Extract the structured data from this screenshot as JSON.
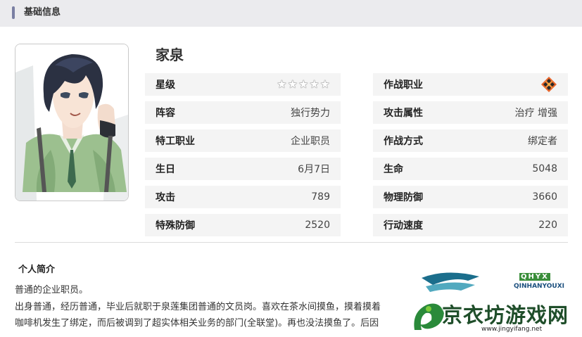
{
  "section": {
    "title": "基础信息"
  },
  "character": {
    "name": "家泉"
  },
  "stats_left": [
    {
      "key": "星级",
      "value": ""
    },
    {
      "key": "阵容",
      "value": "独行势力"
    },
    {
      "key": "特工职业",
      "value": "企业职员"
    },
    {
      "key": "生日",
      "value": "6月7日"
    },
    {
      "key": "攻击",
      "value": "789"
    },
    {
      "key": "特殊防御",
      "value": "2520"
    }
  ],
  "stats_right": [
    {
      "key": "作战职业",
      "value": ""
    },
    {
      "key": "攻击属性",
      "value": "治疗 增强"
    },
    {
      "key": "作战方式",
      "value": "绑定者"
    },
    {
      "key": "生命",
      "value": "5048"
    },
    {
      "key": "物理防御",
      "value": "3660"
    },
    {
      "key": "行动速度",
      "value": "220"
    }
  ],
  "star_rating": {
    "count": 5,
    "icon": "star-outline-icon"
  },
  "role_icon": {
    "name": "role-class-icon",
    "color": "#e8652a"
  },
  "bio": {
    "title": "个人简介",
    "lines": [
      "普通的企业职员。",
      "出身普通，经历普通，毕业后就职于泉莲集团普通的文员岗。喜欢在茶水间摸鱼，摸着摸着",
      "咖啡机发生了绑定，而后被调到了超实体相关业务的部门(全联堂)。再也没法摸鱼了。后因"
    ]
  },
  "watermark": {
    "tag": "QHYX",
    "sub": "QINHANYOUXI",
    "brand": "京衣坊游戏网",
    "url": "www.jingyifang.net"
  },
  "colors": {
    "accent_bar": "#7a7fa3",
    "section_bg": "#ebebee",
    "row_bg": "#f4f4f4"
  }
}
